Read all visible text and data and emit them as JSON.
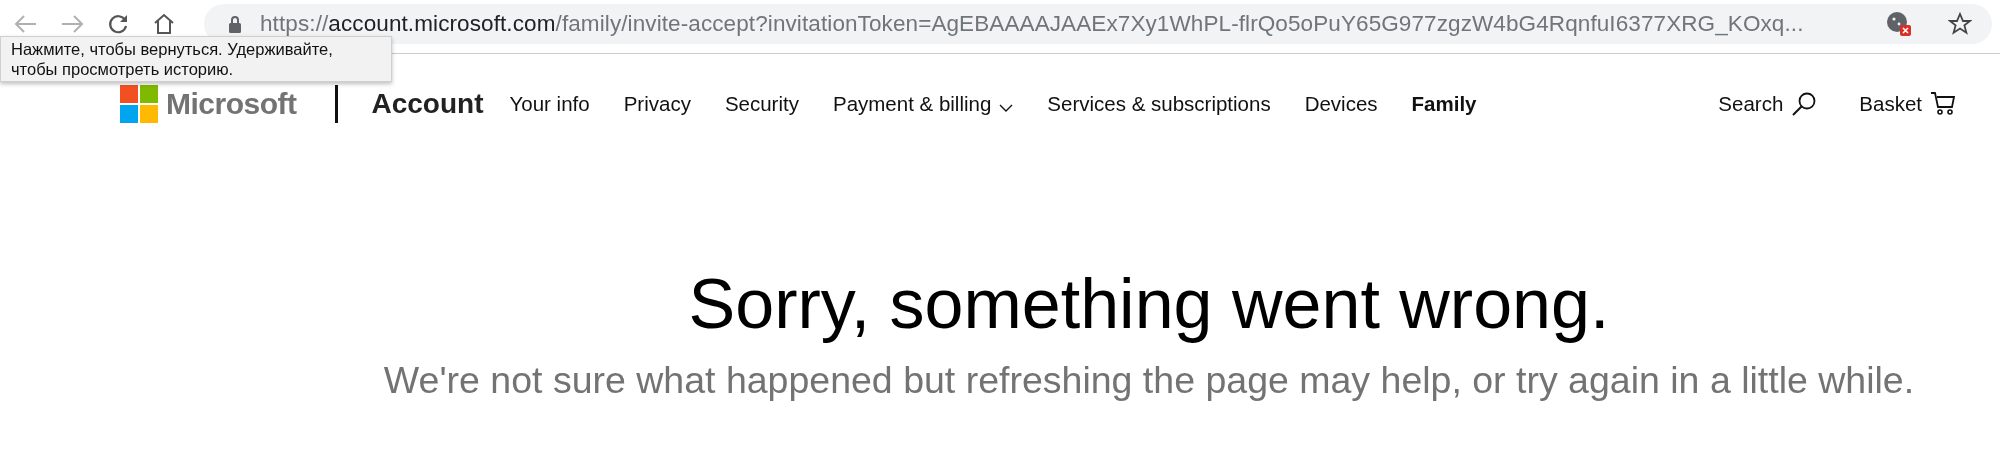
{
  "browser": {
    "url": {
      "scheme": "https://",
      "host": "account.microsoft.com",
      "path": "/family/invite-accept?invitationToken=AgEBAAAAJAAEx7Xy1WhPL-flrQo5oPuY65G977zgzW4bG4RqnfuI6377XRG_KOxq..."
    },
    "tooltip": "Нажмите, чтобы вернуться. Удерживайте, чтобы просмотреть историю."
  },
  "header": {
    "brand": "Microsoft",
    "section": "Account",
    "nav": [
      {
        "label": "Your info",
        "selected": false,
        "dropdown": false
      },
      {
        "label": "Privacy",
        "selected": false,
        "dropdown": false
      },
      {
        "label": "Security",
        "selected": false,
        "dropdown": false
      },
      {
        "label": "Payment & billing",
        "selected": false,
        "dropdown": true
      },
      {
        "label": "Services & subscriptions",
        "selected": false,
        "dropdown": false
      },
      {
        "label": "Devices",
        "selected": false,
        "dropdown": false
      },
      {
        "label": "Family",
        "selected": true,
        "dropdown": false
      }
    ],
    "search": "Search",
    "basket": "Basket"
  },
  "error": {
    "title": "Sorry, something went wrong.",
    "message": "We're not sure what happened but refreshing the page may help, or try again in a little while."
  }
}
